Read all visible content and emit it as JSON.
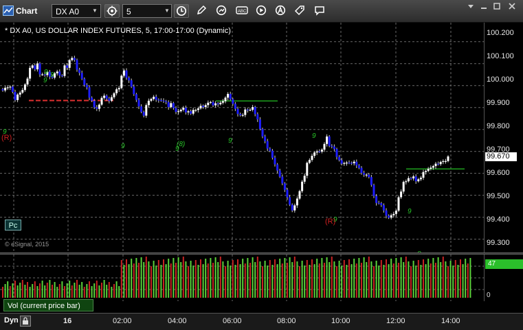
{
  "window": {
    "title": "Chart"
  },
  "toolbar": {
    "symbol": "DX A0",
    "interval": "5",
    "icons": [
      "link-icon",
      "clock-icon",
      "pencil-icon",
      "refresh-icon",
      "label-icon",
      "play-icon",
      "text-icon",
      "tag-icon",
      "comment-icon"
    ]
  },
  "legend": "* DX A0, US DOLLAR INDEX FUTURES, 5, 17:00-17:00 (Dynamic)",
  "price_axis": {
    "labels": [
      "100.200",
      "100.100",
      "100.000",
      "99.900",
      "99.800",
      "99.700",
      "99.600",
      "99.500",
      "99.400",
      "99.300"
    ],
    "last_price": "99.670"
  },
  "pc_button": "Pc",
  "copyright": "© eSignal, 2015",
  "volume": {
    "badge": "47",
    "zero": "0",
    "tab": "Vol (current price bar)"
  },
  "footer": {
    "dyn": "Dyn"
  },
  "time_axis": {
    "labels": [
      "16",
      "02:00",
      "04:00",
      "06:00",
      "08:00",
      "10:00",
      "12:00",
      "14:00"
    ]
  },
  "annotations": {
    "r1": "(R)",
    "r2": "(R)"
  },
  "colors": {
    "up": "#ffffff",
    "down": "#1e1eff",
    "vol_up": "#5ad23a",
    "vol_down": "#c82323",
    "bg": "#000000",
    "grid": "#6a6a6a",
    "last_badge": "#2bbf2b"
  },
  "chart_data": {
    "type": "candlestick",
    "symbol": "DX A0",
    "ylim": [
      99.28,
      100.24
    ],
    "price_labels": [
      100.2,
      100.1,
      100.0,
      99.9,
      99.8,
      99.7,
      99.6,
      99.5,
      99.4,
      99.3
    ],
    "last": 99.67,
    "closes": [
      99.978,
      99.99,
      99.992,
      99.995,
      99.971,
      99.934,
      99.959,
      99.968,
      99.98,
      100.005,
      100.032,
      100.081,
      100.092,
      100.074,
      100.101,
      100.051,
      100.051,
      100.048,
      100.063,
      100.041,
      100.036,
      100.056,
      100.064,
      100.046,
      100.044,
      100.092,
      100.081,
      100.116,
      100.126,
      100.117,
      100.073,
      100.058,
      100.031,
      100.003,
      99.992,
      99.945,
      99.931,
      99.901,
      99.894,
      99.913,
      99.944,
      99.954,
      99.941,
      99.931,
      99.947,
      99.965,
      99.983,
      99.989,
      100.045,
      100.069,
      100.036,
      100.024,
      99.995,
      99.961,
      99.935,
      99.905,
      99.88,
      99.863,
      99.911,
      99.931,
      99.939,
      99.949,
      99.936,
      99.934,
      99.932,
      99.929,
      99.925,
      99.902,
      99.92,
      99.898,
      99.88,
      99.883,
      99.89,
      99.899,
      99.878,
      99.883,
      99.872,
      99.889,
      99.889,
      99.896,
      99.908,
      99.902,
      99.911,
      99.922,
      99.925,
      99.91,
      99.919,
      99.915,
      99.922,
      99.929,
      99.945,
      99.962,
      99.938,
      99.917,
      99.894,
      99.871,
      99.865,
      99.866,
      99.891,
      99.889,
      99.89,
      99.902,
      99.87,
      99.846,
      99.802,
      99.768,
      99.747,
      99.713,
      99.703,
      99.671,
      99.641,
      99.613,
      99.585,
      99.554,
      99.525,
      99.491,
      99.457,
      99.431,
      99.454,
      99.485,
      99.519,
      99.562,
      99.589,
      99.648,
      99.661,
      99.68,
      99.695,
      99.7,
      99.699,
      99.708,
      99.734,
      99.768,
      99.725,
      99.722,
      99.711,
      99.675,
      99.66,
      99.644,
      99.647,
      99.649,
      99.648,
      99.646,
      99.653,
      99.636,
      99.625,
      99.602,
      99.594,
      99.594,
      99.583,
      99.547,
      99.497,
      99.465,
      99.464,
      99.455,
      99.431,
      99.407,
      99.398,
      99.409,
      99.415,
      99.43,
      99.491,
      99.517,
      99.561,
      99.564,
      99.578,
      99.577,
      99.586,
      99.564,
      99.573,
      99.58,
      99.606,
      99.611,
      99.621,
      99.626,
      99.633,
      99.644,
      99.642,
      99.652,
      99.656,
      99.656,
      99.677
    ],
    "x_labels": [
      "16",
      "02:00",
      "04:00",
      "06:00",
      "08:00",
      "10:00",
      "12:00",
      "14:00"
    ],
    "volume_last": 47
  }
}
